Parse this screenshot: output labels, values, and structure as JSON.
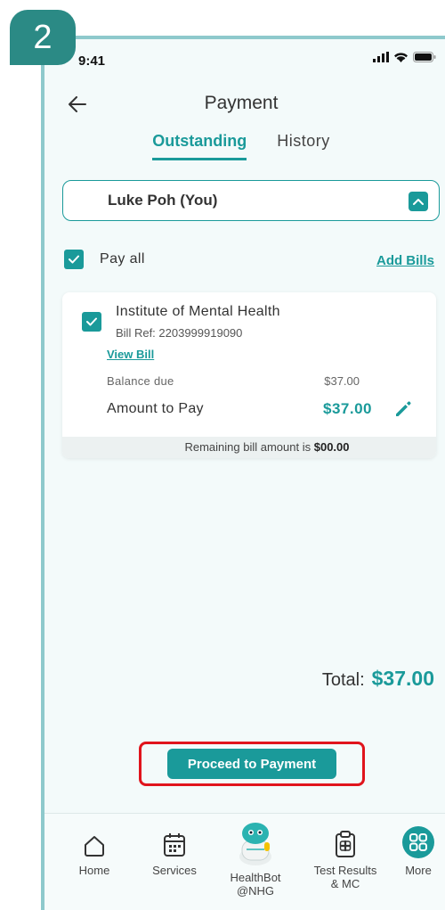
{
  "step_badge": "2",
  "status_bar": {
    "time": "9:41"
  },
  "header": {
    "title": "Payment"
  },
  "tabs": [
    {
      "label": "Outstanding",
      "active": true
    },
    {
      "label": "History",
      "active": false
    }
  ],
  "person_select": {
    "selected": "Luke Poh (You)"
  },
  "pay_all": {
    "label": "Pay all",
    "checked": true,
    "add_bills_label": "Add Bills"
  },
  "bill": {
    "checked": true,
    "institution": "Institute of Mental Health",
    "bill_ref": "Bill Ref: 2203999919090",
    "view_bill_label": "View Bill",
    "balance_label": "Balance due",
    "balance_value": "$37.00",
    "amount_label": "Amount to Pay",
    "amount_value": "$37.00",
    "remaining_prefix": "Remaining bill amount is",
    "remaining_value": "$00.00"
  },
  "total": {
    "label": "Total:",
    "value": "$37.00"
  },
  "proceed_label": "Proceed to Payment",
  "bottom_nav": [
    {
      "label": "Home",
      "icon": "home-icon"
    },
    {
      "label": "Services",
      "icon": "calendar-icon"
    },
    {
      "label": "HealthBot\n@NHG",
      "icon": "healthbot-icon"
    },
    {
      "label": "Test Results\n& MC",
      "icon": "clipboard-icon"
    },
    {
      "label": "More",
      "icon": "more-grid-icon"
    }
  ],
  "colors": {
    "accent": "#1a9a9a",
    "highlight": "#e0141c",
    "badge": "#2b8a85",
    "frame": "#8ec9cc"
  }
}
